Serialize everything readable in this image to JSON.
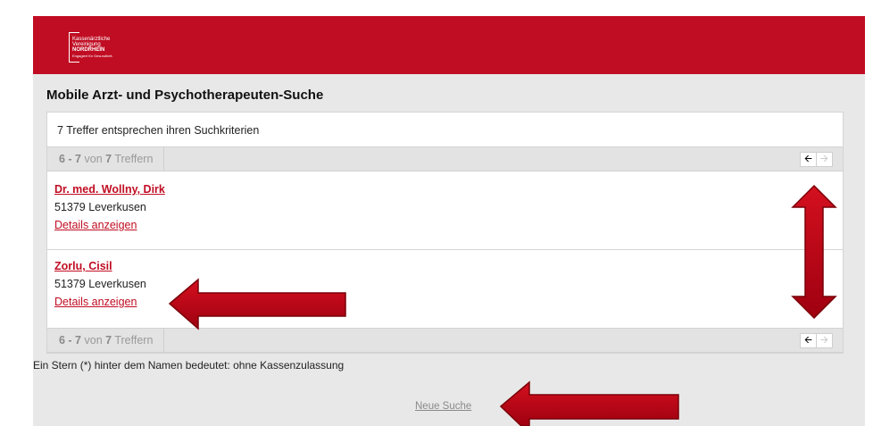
{
  "header": {
    "logo": {
      "line1": "Kassenärztliche",
      "line2": "Vereinigung",
      "line3": "NORDRHEIN",
      "tagline": "Engagiert für Gesundheit."
    },
    "brand_color": "#c00d23"
  },
  "page_title": "Mobile Arzt- und Psychotherapeuten-Suche",
  "results": {
    "summary": "7 Treffer entsprechen ihren Suchkriterien",
    "pager": {
      "range": "6 - 7",
      "von": "von",
      "total": "7",
      "suffix": "Treffern",
      "prev_icon": "arrow-left-icon",
      "next_icon": "arrow-right-icon"
    },
    "entries": [
      {
        "name": "Dr. med. Wollny, Dirk",
        "city": "51379 Leverkusen",
        "details": "Details anzeigen"
      },
      {
        "name": "Zorlu, Cisil",
        "city": "51379 Leverkusen",
        "details": "Details anzeigen"
      }
    ]
  },
  "footnote": "Ein Stern (*) hinter dem Namen bedeutet: ohne Kassenzulassung",
  "new_search": "Neue Suche",
  "annotation_color": "#b8000f"
}
